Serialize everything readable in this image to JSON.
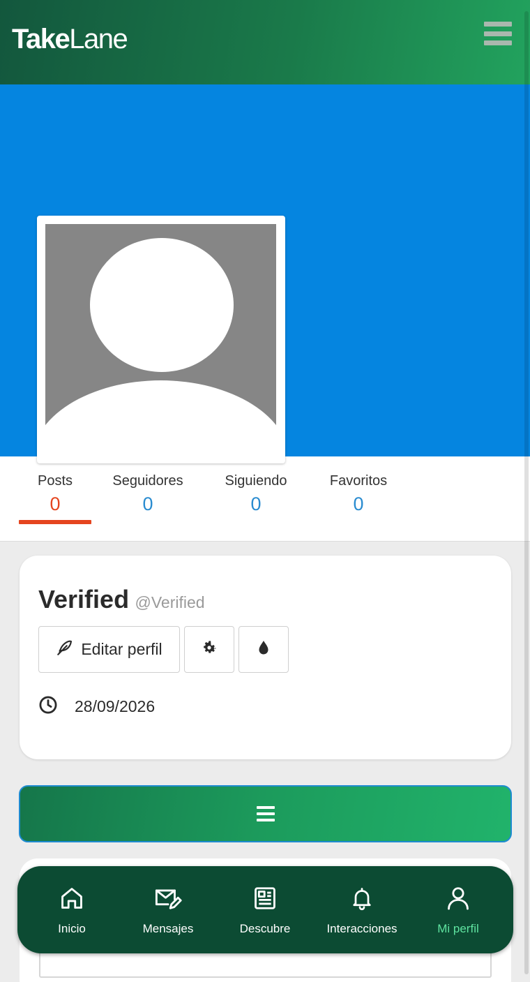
{
  "header": {
    "brand_bold": "Take",
    "brand_light": "Lane",
    "menu_icon": "hamburger-icon"
  },
  "cover": {
    "color": "#0585e0"
  },
  "stats": [
    {
      "label": "Posts",
      "value": "0"
    },
    {
      "label": "Seguidores",
      "value": "0"
    },
    {
      "label": "Siguiendo",
      "value": "0"
    },
    {
      "label": "Favoritos",
      "value": "0"
    }
  ],
  "profile": {
    "name": "Verified",
    "handle": "@Verified",
    "edit_label": "Editar perfil",
    "date": "28/09/2026"
  },
  "nav": {
    "items": [
      {
        "label": "Inicio",
        "icon": "home-icon"
      },
      {
        "label": "Mensajes",
        "icon": "mail-edit-icon"
      },
      {
        "label": "Descubre",
        "icon": "newspaper-icon"
      },
      {
        "label": "Interacciones",
        "icon": "bell-icon"
      },
      {
        "label": "Mi perfil",
        "icon": "user-icon"
      }
    ],
    "active_color": "#5fe3a0"
  },
  "colors": {
    "accent_red": "#e5451f",
    "stat_blue": "#2a8cd0",
    "nav_bg": "#0c4b33"
  }
}
